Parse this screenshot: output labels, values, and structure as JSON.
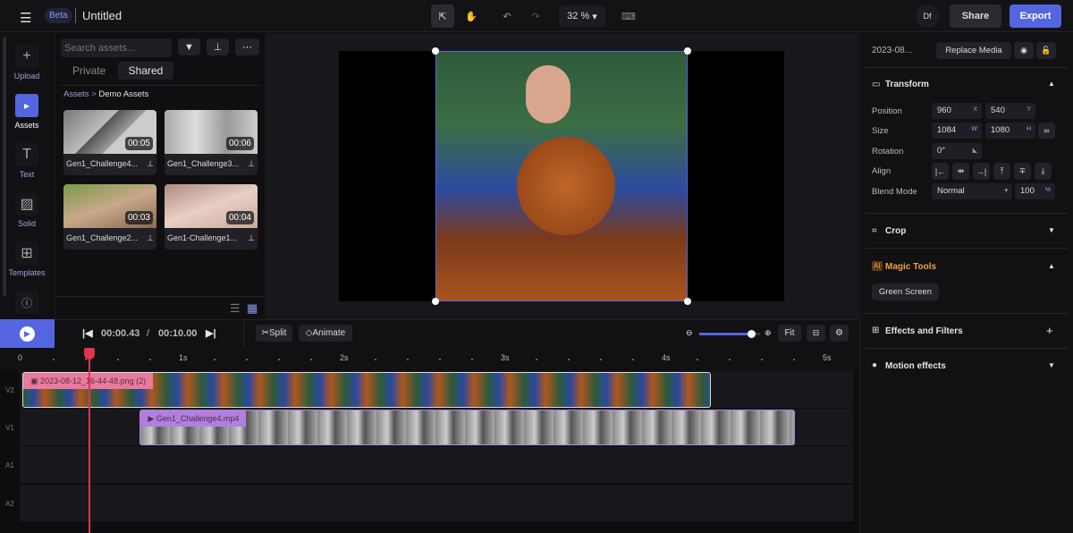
{
  "topbar": {
    "beta": "Beta",
    "title": "Untitled",
    "zoom": "32 %",
    "avatar": "Df",
    "share": "Share",
    "export": "Export"
  },
  "rail": [
    {
      "label": "Upload",
      "icon": "plus-icon"
    },
    {
      "label": "Assets",
      "icon": "folder-play-icon"
    },
    {
      "label": "Text",
      "icon": "text-icon"
    },
    {
      "label": "Solid",
      "icon": "hatch-icon"
    },
    {
      "label": "Templates",
      "icon": "layout-icon"
    }
  ],
  "assets": {
    "search_placeholder": "Search assets...",
    "tabs": [
      "Private",
      "Shared"
    ],
    "active_tab": "Shared",
    "breadcrumb_root": "Assets",
    "breadcrumb_sep": ">",
    "breadcrumb_current": "Demo Assets",
    "items": [
      {
        "name": "Gen1_Challenge4...",
        "duration": "00:05"
      },
      {
        "name": "Gen1_Challenge3...",
        "duration": "00:06"
      },
      {
        "name": "Gen1_Challenge2...",
        "duration": "00:03"
      },
      {
        "name": "Gen1-Challenge1...",
        "duration": "00:04"
      }
    ]
  },
  "props": {
    "file": "2023-08...",
    "replace": "Replace Media",
    "transform": "Transform",
    "position_label": "Position",
    "pos_x": "960",
    "pos_y": "540",
    "size_label": "Size",
    "w": "1084",
    "h": "1080",
    "rotation_label": "Rotation",
    "rotation": "0°",
    "align_label": "Align",
    "blend_label": "Blend Mode",
    "blend": "Normal",
    "opacity": "100",
    "u_x": "X",
    "u_y": "Y",
    "u_w": "W",
    "u_h": "H",
    "u_pct": "%",
    "crop": "Crop",
    "magic": "Magic Tools",
    "magic_badge": "AI",
    "green": "Green Screen",
    "effects": "Effects and Filters",
    "motion": "Motion effects"
  },
  "timeline": {
    "current": "00:00.43",
    "sep": "/",
    "total": "00:10.00",
    "split": "Split",
    "animate": "Animate",
    "fit": "Fit",
    "zoom_level": 0.85,
    "ruler": [
      "0",
      "1s",
      "2s",
      "3s",
      "4s",
      "5s"
    ],
    "tracks": [
      "V2",
      "V1",
      "A1",
      "A2"
    ],
    "clips": [
      {
        "track": "V2",
        "name": "2023-08-12_16-44-48.png (2)",
        "start": 0.0,
        "end": 4.28
      },
      {
        "track": "V1",
        "name": "Gen1_Challenge4.mp4",
        "start": 0.73,
        "end": 4.8
      }
    ],
    "playhead": 0.43
  },
  "colors": {
    "accent": "#5366e0",
    "clip_image": "#e87a9c",
    "clip_video": "#b07fe0",
    "playhead": "#e0344f"
  }
}
